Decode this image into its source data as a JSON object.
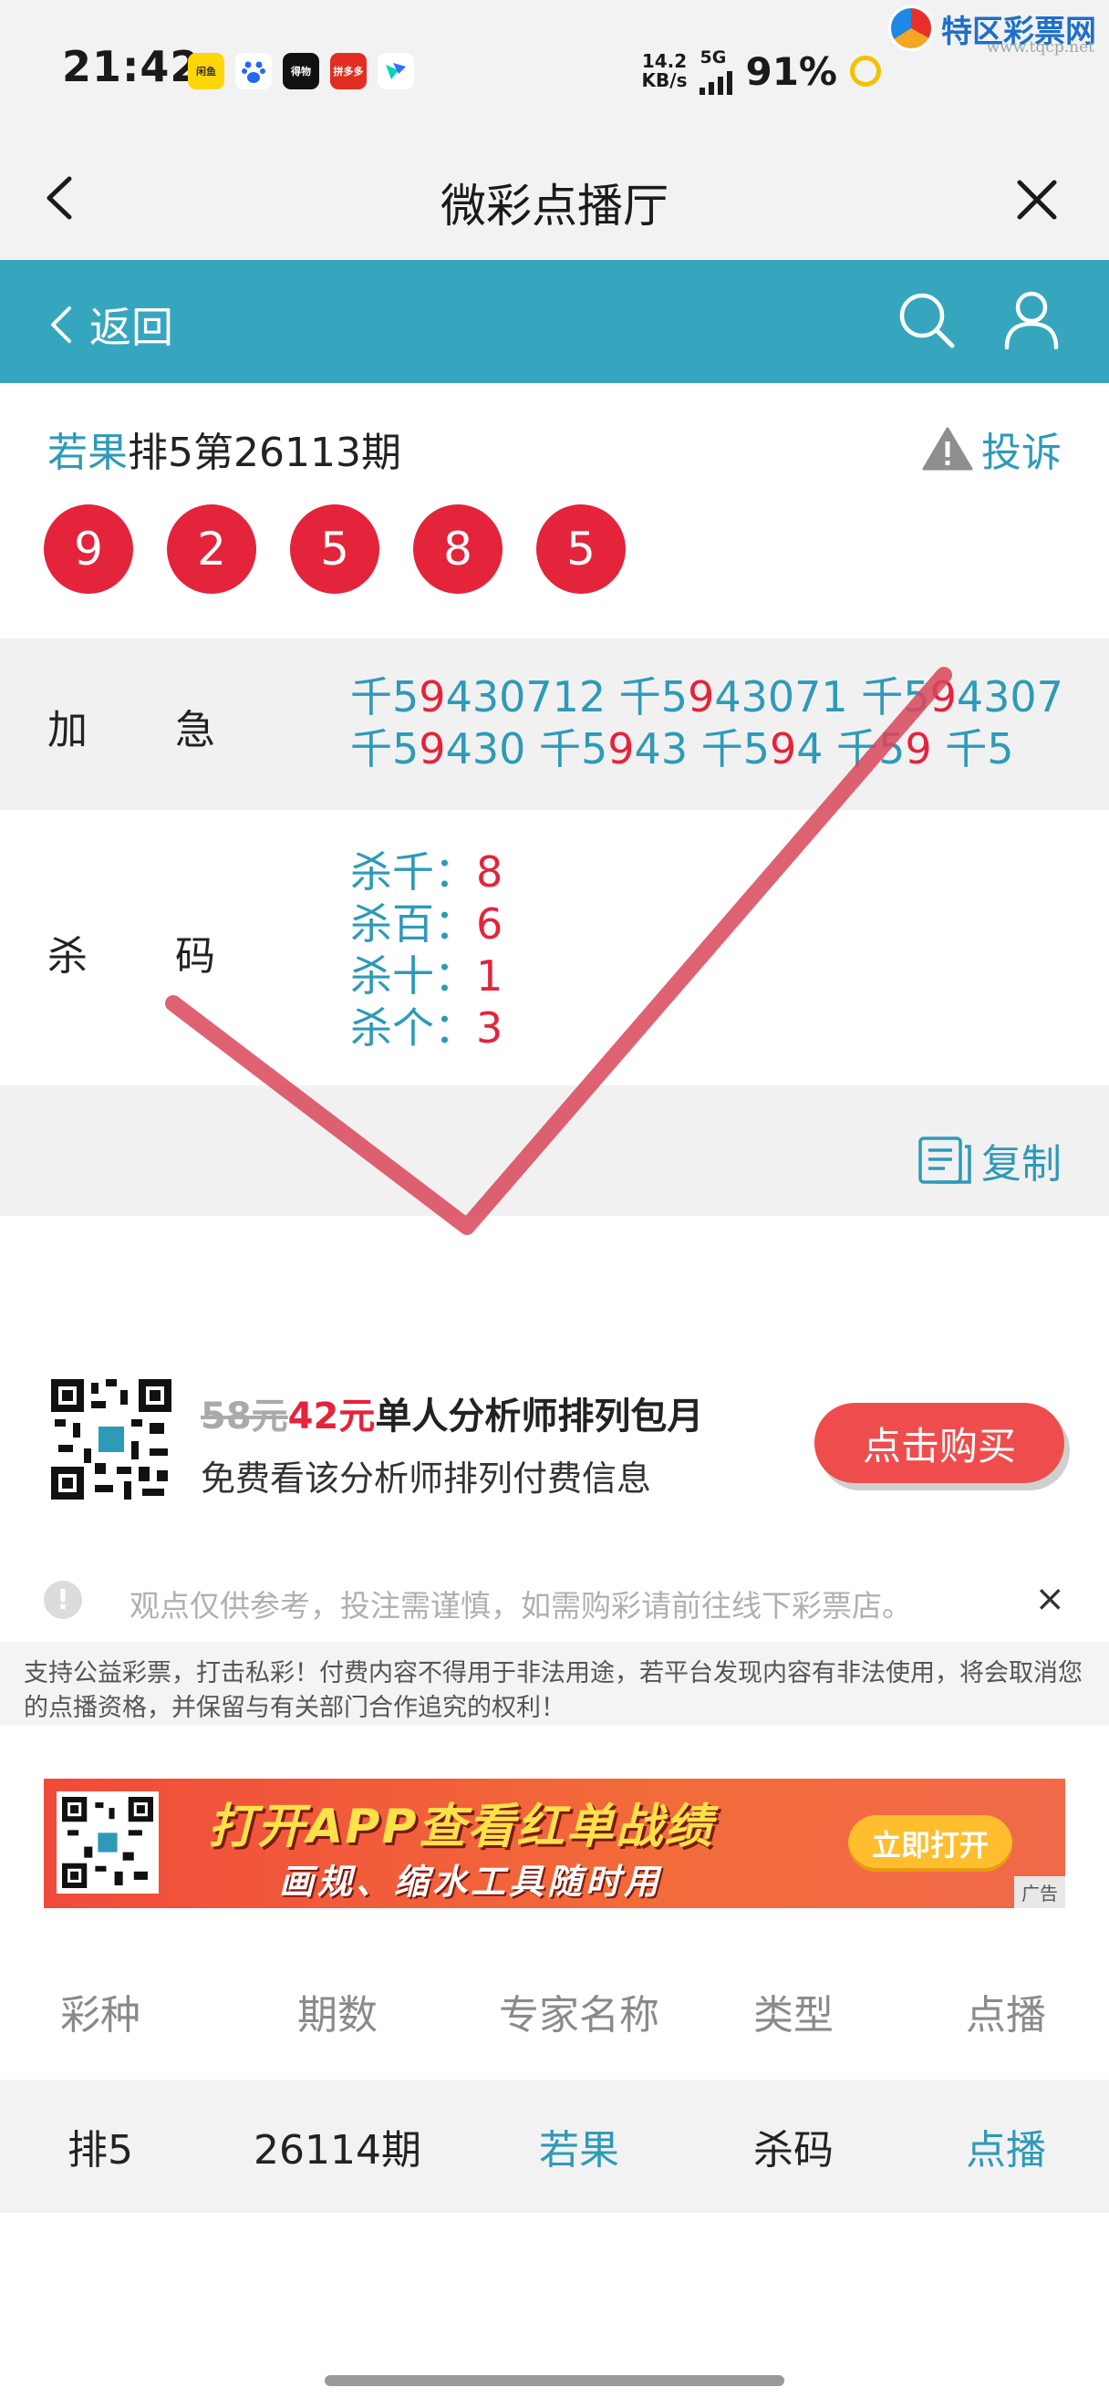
{
  "status_bar": {
    "time": "21:42",
    "app_icons": [
      "闲鱼",
      "百度",
      "得物",
      "拼多多",
      "飞书"
    ],
    "speed": "14.2",
    "speed_unit": "KB/s",
    "network": "5G",
    "battery": "91%",
    "watermark_text": "特区彩票网",
    "watermark_url": "www.tqcp.net"
  },
  "nav": {
    "title": "微彩点播厅"
  },
  "toolbar": {
    "back_label": "返回"
  },
  "issue": {
    "expert": "若果",
    "title": "排5第26113期",
    "complain_label": "投诉",
    "balls": [
      "9",
      "2",
      "5",
      "8",
      "5"
    ]
  },
  "urgent": {
    "label": "加急",
    "lines": [
      [
        [
          "千5",
          ""
        ],
        [
          "9",
          "hl"
        ],
        [
          "430712 千5",
          ""
        ],
        [
          "9",
          "hl"
        ],
        [
          "43071 千5",
          ""
        ],
        [
          "9",
          "hl"
        ],
        [
          "4307",
          ""
        ]
      ],
      [
        [
          "千5",
          ""
        ],
        [
          "9",
          "hl"
        ],
        [
          "430 千5",
          ""
        ],
        [
          "9",
          "hl"
        ],
        [
          "43 千5",
          ""
        ],
        [
          "9",
          "hl"
        ],
        [
          "4 千5",
          ""
        ],
        [
          "9",
          "hl"
        ],
        [
          " 千5",
          ""
        ]
      ]
    ]
  },
  "kill": {
    "label": "杀码",
    "items": [
      {
        "name": "杀千：",
        "value": "8"
      },
      {
        "name": "杀百：",
        "value": "6"
      },
      {
        "name": "杀十：",
        "value": "1"
      },
      {
        "name": "杀个：",
        "value": "3"
      }
    ]
  },
  "copy_label": "复制",
  "promo": {
    "old_price": "58元",
    "new_price": "42元",
    "title_rest": "单人分析师排列包月",
    "subtitle": "免费看该分析师排列付费信息",
    "buy_label": "点击购买"
  },
  "notice": {
    "text": "观点仅供参考，投注需谨慎，如需购彩请前往线下彩票店。",
    "close": "×"
  },
  "disclaimer": "支持公益彩票，打击私彩！付费内容不得用于非法用途，若平台发现内容有非法使用，将会取消您的点播资格，并保留与有关部门合作追究的权利！",
  "ad": {
    "title": "打开APP查看红单战绩",
    "subtitle": "画规、缩水工具随时用",
    "button": "立即打开",
    "tag": "广告"
  },
  "table": {
    "headers": [
      "彩种",
      "期数",
      "专家名称",
      "类型",
      "点播"
    ],
    "rows": [
      {
        "lottery": "排5",
        "period": "26114期",
        "expert": "若果",
        "type": "杀码",
        "action": "点播"
      }
    ]
  },
  "colors": {
    "accent": "#36a6be",
    "link": "#2e9ab8",
    "red": "#e3243b"
  }
}
